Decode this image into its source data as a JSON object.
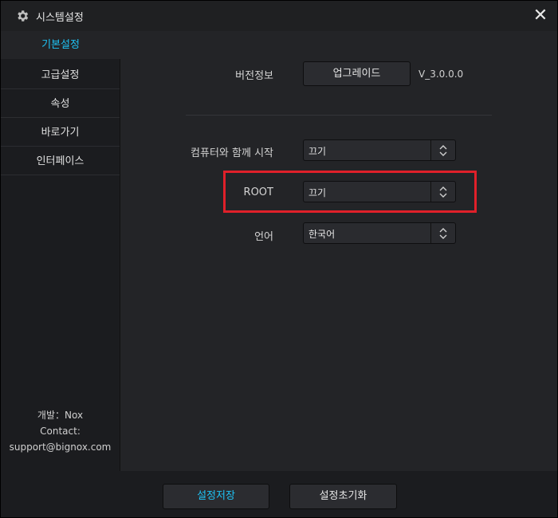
{
  "window": {
    "title": "시스템설정",
    "title_icon": "gear-icon",
    "close_glyph": "✕"
  },
  "sidebar": {
    "items": [
      {
        "label": "기본설정",
        "active": true
      },
      {
        "label": "고급설정",
        "active": false
      },
      {
        "label": "속성",
        "active": false
      },
      {
        "label": "바로가기",
        "active": false
      },
      {
        "label": "인터페이스",
        "active": false
      }
    ],
    "dev_info": {
      "line1": "개발：Nox",
      "line2": "Contact:",
      "line3": "support@bignox.com"
    }
  },
  "main": {
    "version_label": "버전정보",
    "upgrade_label": "업그레이드",
    "version_value": "V_3.0.0.0",
    "startup_label": "컴퓨터와 함께 시작",
    "startup_value": "끄기",
    "root_label": "ROOT",
    "root_value": "끄기",
    "language_label": "언어",
    "language_value": "한국어"
  },
  "footer": {
    "save_label": "설정저장",
    "reset_label": "설정초기화"
  },
  "colors": {
    "accent": "#1ec3f5",
    "highlight": "#e0202a",
    "background": "#232427"
  }
}
